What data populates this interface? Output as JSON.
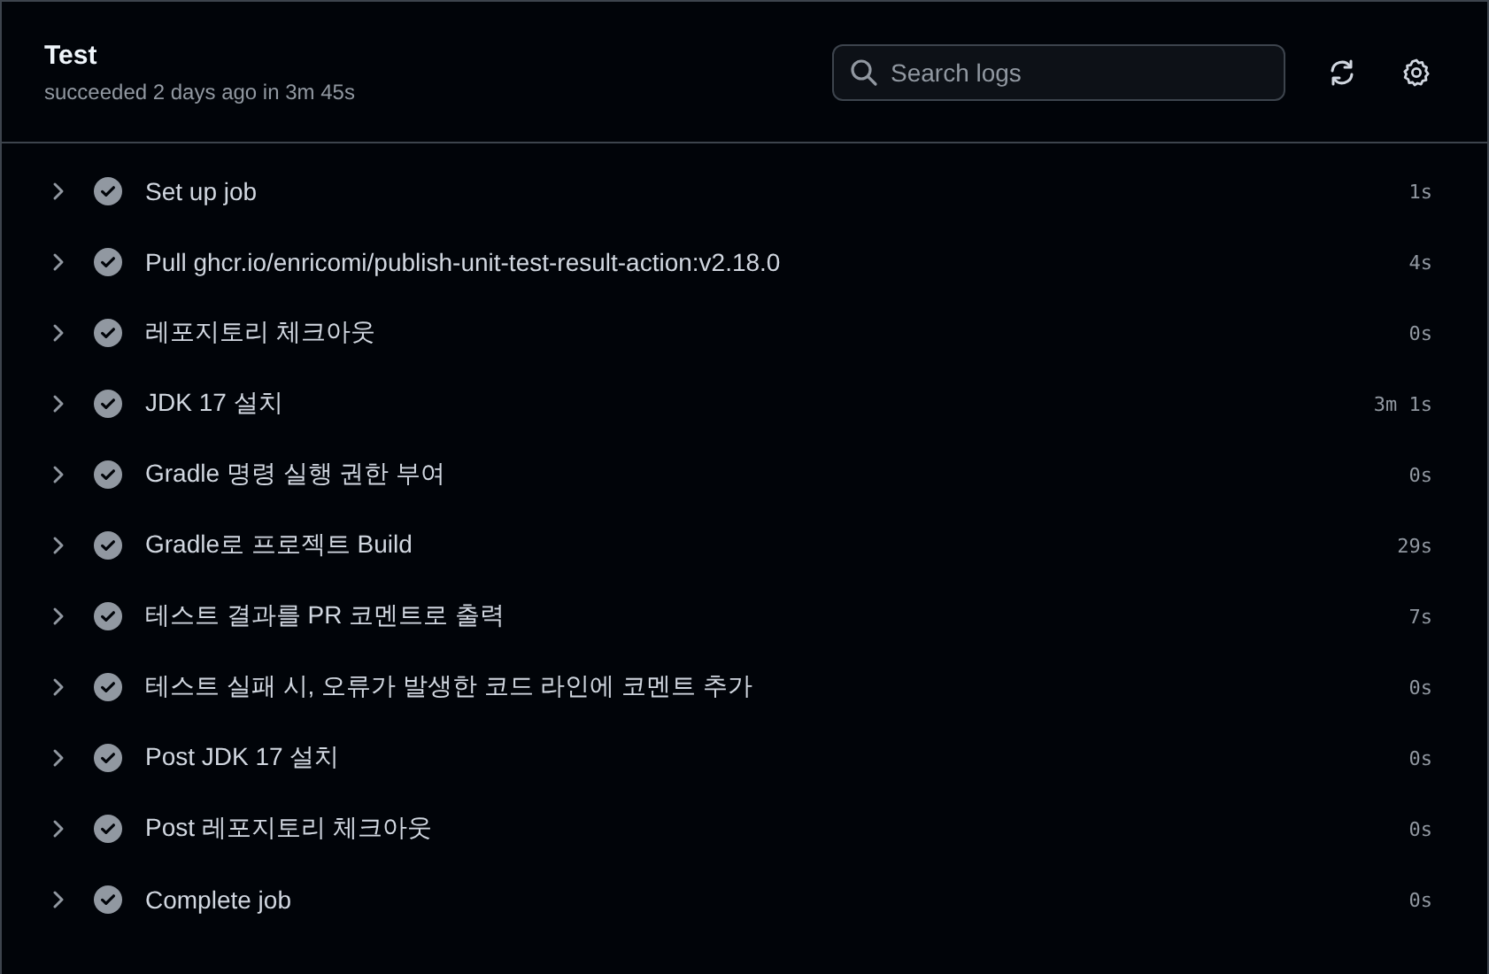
{
  "job": {
    "title": "Test",
    "summary": "succeeded 2 days ago in 3m 45s"
  },
  "search": {
    "placeholder": "Search logs"
  },
  "steps": [
    {
      "name": "Set up job",
      "duration": "1s",
      "expanded": false
    },
    {
      "name": "Pull ghcr.io/enricomi/publish-unit-test-result-action:v2.18.0",
      "duration": "4s",
      "expanded": false
    },
    {
      "name": "레포지토리 체크아웃",
      "duration": "0s",
      "expanded": false
    },
    {
      "name": "JDK 17 설치",
      "duration": "3m 1s",
      "expanded": false
    },
    {
      "name": "Gradle 명령 실행 권한 부여",
      "duration": "0s",
      "expanded": false
    },
    {
      "name": "Gradle로 프로젝트 Build",
      "duration": "29s",
      "expanded": false
    },
    {
      "name": "테스트 결과를 PR 코멘트로 출력",
      "duration": "7s",
      "expanded": false
    },
    {
      "name": "테스트 실패 시, 오류가 발생한 코드 라인에 코멘트 추가",
      "duration": "0s",
      "expanded": false
    },
    {
      "name": "Post JDK 17 설치",
      "duration": "0s",
      "expanded": false
    },
    {
      "name": "Post 레포지토리 체크아웃",
      "duration": "0s",
      "expanded": false
    },
    {
      "name": "Complete job",
      "duration": "0s",
      "expanded": false
    }
  ]
}
